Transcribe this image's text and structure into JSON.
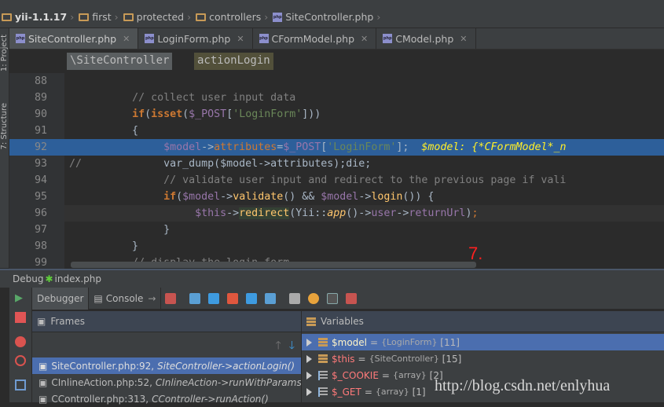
{
  "breadcrumb": [
    "yii-1.1.17",
    "first",
    "protected",
    "controllers",
    "SiteController.php"
  ],
  "left_tabs": [
    "1: Project",
    "7: Structure"
  ],
  "editor_tabs": [
    {
      "label": "SiteController.php",
      "active": true
    },
    {
      "label": "LoginForm.php"
    },
    {
      "label": "CFormModel.php"
    },
    {
      "label": "CModel.php"
    }
  ],
  "method_crumbs": {
    "class": "\\SiteController",
    "method": "actionLogin"
  },
  "code": {
    "line_numbers": [
      "88",
      "89",
      "90",
      "91",
      "92",
      "93",
      "94",
      "95",
      "96",
      "97",
      "98",
      "99"
    ],
    "l89": "// collect user input data",
    "l90_kw": "if",
    "l90_fn": "isset",
    "l90_var": "$_POST",
    "l90_str": "'LoginForm'",
    "l92_var": "$model",
    "l92_prop": "attributes",
    "l92_post": "$_POST",
    "l92_str": "'LoginForm'",
    "l92_hint": "$model: {*CFormModel*_n",
    "l93_prefix": "//",
    "l93": "var_dump($model->attributes);die;",
    "l94": "// validate user input and redirect to the previous page if vali",
    "l95_kw": "if",
    "l95_var": "$model",
    "l95_fn1": "validate",
    "l95_fn2": "login",
    "l96_var": "$this",
    "l96_fn": "redirect",
    "l96_cls": "Yii",
    "l96_app": "app",
    "l96_user": "user",
    "l96_ret": "returnUrl",
    "l99": "// display the login form"
  },
  "annotation": "7.",
  "debug": {
    "title": "Debug",
    "config": "index.php",
    "tabs": [
      "Debugger",
      "Console"
    ],
    "frames_title": "Frames",
    "frames": [
      {
        "file": "SiteController.php:92,",
        "method": "SiteController->actionLogin()",
        "selected": true
      },
      {
        "file": "CInlineAction.php:52,",
        "method": "CInlineAction->runWithParams"
      },
      {
        "file": "CController.php:313,",
        "method": "CController->runAction()"
      }
    ],
    "variables_title": "Variables",
    "variables": [
      {
        "name": "$model",
        "type": "{LoginForm}",
        "count": "[11]",
        "icon": "object",
        "selected": true
      },
      {
        "name": "$this",
        "type": "{SiteController}",
        "count": "[15]",
        "icon": "object"
      },
      {
        "name": "$_COOKIE",
        "type": "{array}",
        "count": "[2]",
        "icon": "array"
      },
      {
        "name": "$_GET",
        "type": "{array}",
        "count": "[1]",
        "icon": "array"
      }
    ]
  },
  "watermark": "http://blog.csdn.net/enlyhua",
  "colors": {
    "execution_line": "#2d5f9a",
    "selection": "#4b6eaf",
    "keyword": "#cc7832",
    "variable": "#9876aa",
    "string": "#6a8759"
  }
}
